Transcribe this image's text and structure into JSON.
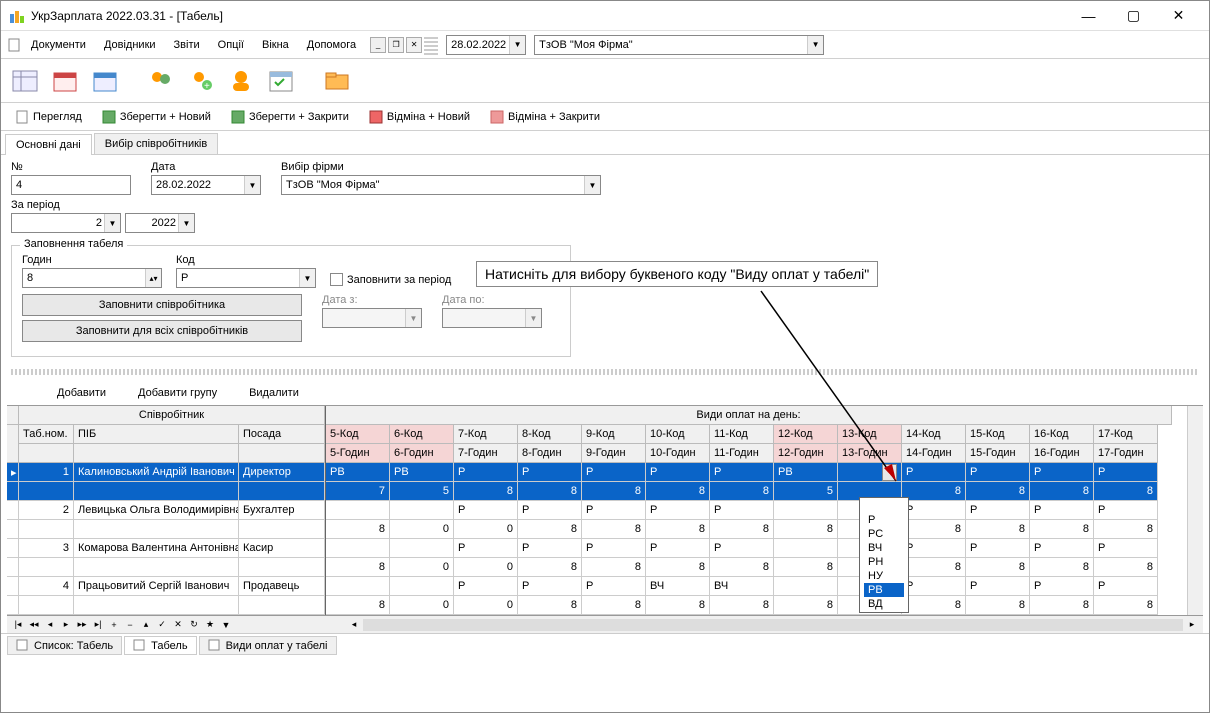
{
  "window": {
    "title": "УкрЗарплата 2022.03.31 - [Табель]"
  },
  "menu": {
    "documents": "Документи",
    "directories": "Довідники",
    "reports": "Звіти",
    "options": "Опції",
    "windows": "Вікна",
    "help": "Допомога"
  },
  "top_date": "28.02.2022",
  "top_firm": "ТзОВ \"Моя Фірма\"",
  "actions": {
    "preview": "Перегляд",
    "save_new": "Зберегти + Новий",
    "save_close": "Зберегти + Закрити",
    "cancel_new": "Відміна + Новий",
    "cancel_close": "Відміна + Закрити"
  },
  "tabs": {
    "main": "Основні дані",
    "employees": "Вибір співробітників"
  },
  "form": {
    "num_label": "№",
    "num": "4",
    "date_label": "Дата",
    "date": "28.02.2022",
    "firm_label": "Вибір фірми",
    "firm": "ТзОВ \"Моя Фірма\"",
    "period_label": "За період",
    "period_m": "2",
    "period_y": "2022",
    "group_title": "Заповнення табеля",
    "hours_label": "Годин",
    "hours": "8",
    "code_label": "Код",
    "code": "Р",
    "fill_period": "Заповнити за період",
    "date_from": "Дата з:",
    "date_to": "Дата по:",
    "fill_emp": "Заповнити співробітника",
    "fill_all": "Заповнити для всіх співробітників"
  },
  "grid_actions": {
    "add": "Добавити",
    "add_group": "Добавити групу",
    "delete": "Видалити"
  },
  "grid_headers": {
    "employee": "Співробітник",
    "tabnum": "Таб.ном.",
    "pib": "ПІБ",
    "position": "Посада",
    "day_header": "Види оплат на день:",
    "cols": [
      {
        "k": "5-Код",
        "g": "5-Годин",
        "pink": true
      },
      {
        "k": "6-Код",
        "g": "6-Годин",
        "pink": true
      },
      {
        "k": "7-Код",
        "g": "7-Годин"
      },
      {
        "k": "8-Код",
        "g": "8-Годин"
      },
      {
        "k": "9-Код",
        "g": "9-Годин"
      },
      {
        "k": "10-Код",
        "g": "10-Годин"
      },
      {
        "k": "11-Код",
        "g": "11-Годин"
      },
      {
        "k": "12-Код",
        "g": "12-Годин",
        "pink": true
      },
      {
        "k": "13-Код",
        "g": "13-Годин",
        "pink": true
      },
      {
        "k": "14-Код",
        "g": "14-Годин"
      },
      {
        "k": "15-Код",
        "g": "15-Годин"
      },
      {
        "k": "16-Код",
        "g": "16-Годин"
      },
      {
        "k": "17-Код",
        "g": "17-Годин"
      }
    ]
  },
  "rows": [
    {
      "n": "1",
      "name": "Калиновський Андрій Іванович",
      "pos": "Директор",
      "sel": true,
      "codes": [
        "РВ",
        "РВ",
        "Р",
        "Р",
        "Р",
        "Р",
        "Р",
        "РВ",
        "",
        "Р",
        "Р",
        "Р",
        "Р"
      ],
      "hours": [
        "7",
        "5",
        "8",
        "8",
        "8",
        "8",
        "8",
        "5",
        "",
        "8",
        "8",
        "8",
        "8"
      ]
    },
    {
      "n": "2",
      "name": "Левицька Ольга Володимирівна",
      "pos": "Бухгалтер",
      "codes": [
        "",
        "",
        "Р",
        "Р",
        "Р",
        "Р",
        "Р",
        "",
        "",
        "Р",
        "Р",
        "Р",
        "Р"
      ],
      "hours": [
        "8",
        "0",
        "0",
        "8",
        "8",
        "8",
        "8",
        "8",
        "",
        "8",
        "8",
        "8",
        "8"
      ]
    },
    {
      "n": "3",
      "name": "Комарова Валентина Антонівна",
      "pos": "Касир",
      "codes": [
        "",
        "",
        "Р",
        "Р",
        "Р",
        "Р",
        "Р",
        "",
        "",
        "Р",
        "Р",
        "Р",
        "Р"
      ],
      "hours": [
        "8",
        "0",
        "0",
        "8",
        "8",
        "8",
        "8",
        "8",
        "",
        "8",
        "8",
        "8",
        "8"
      ]
    },
    {
      "n": "4",
      "name": "Працьовитий Сергій Іванович",
      "pos": "Продавець",
      "codes": [
        "",
        "",
        "Р",
        "Р",
        "Р",
        "ВЧ",
        "ВЧ",
        "",
        "",
        "Р",
        "Р",
        "Р",
        "Р"
      ],
      "hours": [
        "8",
        "0",
        "0",
        "8",
        "8",
        "8",
        "8",
        "8",
        "",
        "8",
        "8",
        "8",
        "8"
      ]
    }
  ],
  "dropdown_options": [
    "Р",
    "РС",
    "ВЧ",
    "РН",
    "НУ",
    "РВ",
    "ВД"
  ],
  "tooltip": "Натисніть для вибору буквеного коду \"Виду оплат у табелі\"",
  "bottom_tabs": {
    "list": "Список: Табель",
    "tabel": "Табель",
    "types": "Види оплат у табелі"
  }
}
